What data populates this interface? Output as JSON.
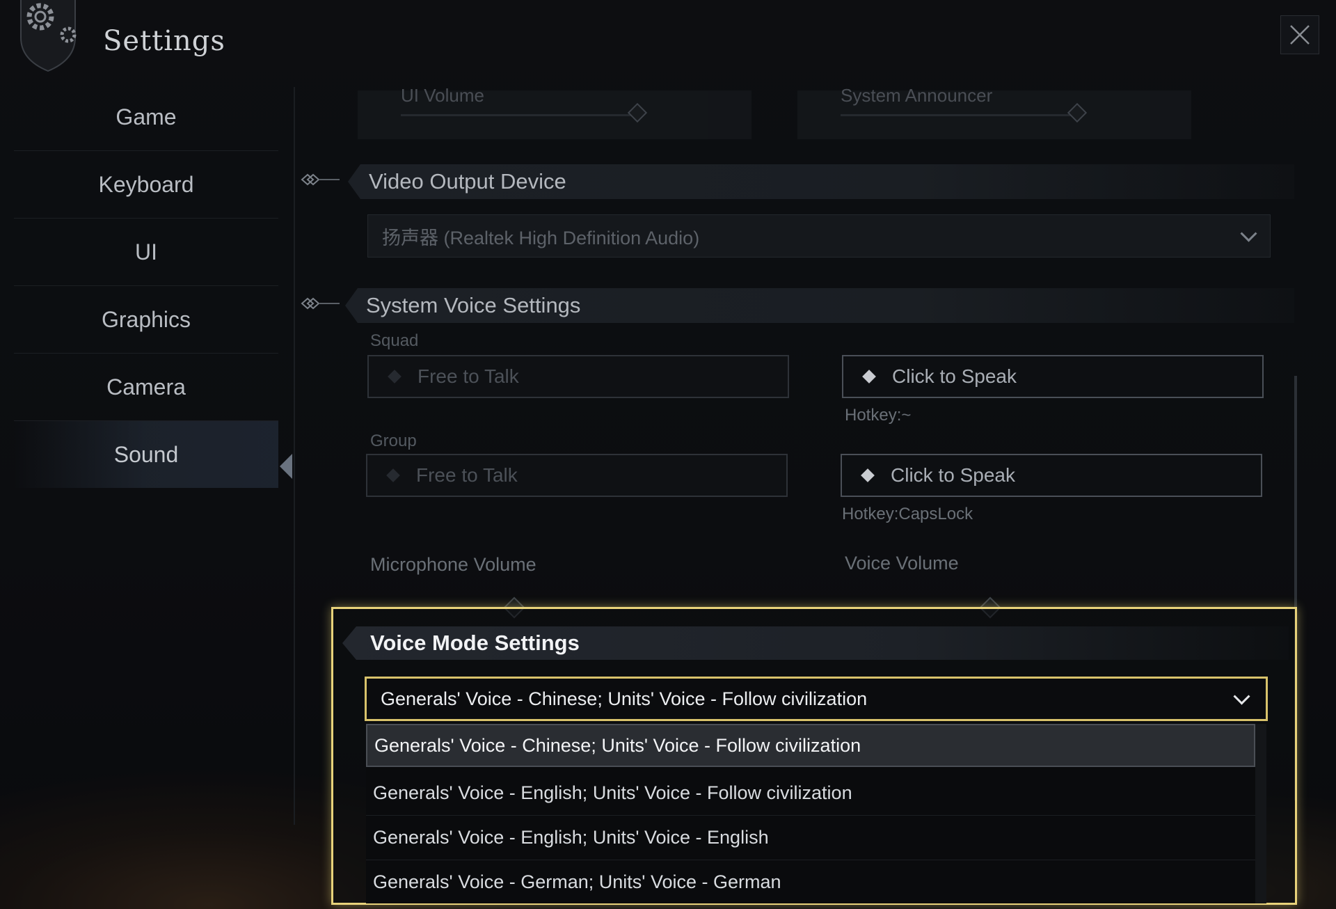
{
  "header": {
    "title": "Settings",
    "close_icon": "close-icon"
  },
  "sidebar": {
    "items": [
      {
        "label": "Game"
      },
      {
        "label": "Keyboard"
      },
      {
        "label": "UI"
      },
      {
        "label": "Graphics"
      },
      {
        "label": "Camera"
      },
      {
        "label": "Sound",
        "active": true
      }
    ]
  },
  "top_sliders": {
    "left_label": "UI Volume",
    "right_label": "System Announcer"
  },
  "video_output": {
    "heading": "Video Output Device",
    "value": "扬声器 (Realtek High Definition Audio)"
  },
  "system_voice": {
    "heading": "System Voice Settings",
    "squad": {
      "label": "Squad",
      "option_free": "Free to Talk",
      "option_click": "Click to Speak",
      "hotkey": "Hotkey:~"
    },
    "group": {
      "label": "Group",
      "option_free": "Free to Talk",
      "option_click": "Click to Speak",
      "hotkey": "Hotkey:CapsLock"
    },
    "microphone_volume_label": "Microphone Volume",
    "voice_volume_label": "Voice Volume"
  },
  "voice_mode": {
    "heading": "Voice Mode Settings",
    "selected": "Generals' Voice - Chinese; Units' Voice - Follow civilization",
    "options": [
      "Generals' Voice - Chinese; Units' Voice - Follow civilization",
      "Generals' Voice - English;  Units' Voice - Follow civilization",
      "Generals' Voice - English;  Units' Voice - English",
      "Generals' Voice - German; Units' Voice - German"
    ]
  },
  "colors": {
    "highlight": "#e8d27a",
    "text_primary": "#eceef0"
  }
}
